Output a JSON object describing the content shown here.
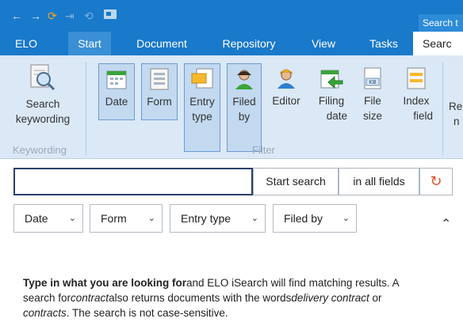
{
  "titlebar": {
    "search_badge": "Search t"
  },
  "tabs": [
    {
      "label": "ELO"
    },
    {
      "label": "Start"
    },
    {
      "label": "Document"
    },
    {
      "label": "Repository"
    },
    {
      "label": "View"
    },
    {
      "label": "Tasks"
    },
    {
      "label": "Searc"
    }
  ],
  "ribbon": {
    "search_keywording": [
      "Search",
      "keywording"
    ],
    "group_keywording": "Keywording",
    "group_filter": "Filter",
    "filter_buttons": [
      {
        "line1": "Date",
        "line2": "",
        "icon": "calendar-icon",
        "selected": true
      },
      {
        "line1": "Form",
        "line2": "",
        "icon": "form-icon",
        "selected": true
      },
      {
        "line1": "Entry",
        "line2": "type",
        "icon": "entry-type-icon",
        "selected": true
      },
      {
        "line1": "Filed",
        "line2": "by",
        "icon": "user-icon",
        "selected": true
      },
      {
        "line1": "Editor",
        "line2": "",
        "icon": "editor-icon",
        "selected": false
      },
      {
        "line1": "Filing",
        "line2": "date",
        "icon": "filing-date-icon",
        "selected": false
      },
      {
        "line1": "File",
        "line2": "size",
        "icon": "file-size-icon",
        "selected": false
      },
      {
        "line1": "Index",
        "line2": "field",
        "icon": "index-field-icon",
        "selected": false
      }
    ],
    "partial": [
      "Re",
      "n"
    ]
  },
  "search": {
    "input_value": "",
    "start_label": "Start search",
    "fields_label": "in all fields",
    "reset_icon": "refresh-icon"
  },
  "filters": [
    {
      "label": "Date"
    },
    {
      "label": "Form"
    },
    {
      "label": "Entry type"
    },
    {
      "label": "Filed by"
    }
  ],
  "help": {
    "line1_bold": "Type in what you are looking for",
    "line1_rest": "and ELO iSearch will find matching results. A",
    "line2_a": "search for",
    "line2_em1": "contract",
    "line2_b": "also returns documents with the words",
    "line2_em2": "delivery contract",
    "line2_c": " or",
    "line3_em": "contracts",
    "line3_rest": ". The search is not case-sensitive."
  },
  "colors": {
    "titlebar": "#1979ca",
    "ribbon": "#dbe8f6",
    "accent_orange": "#f5a623",
    "accent_green": "#3aa33a"
  }
}
